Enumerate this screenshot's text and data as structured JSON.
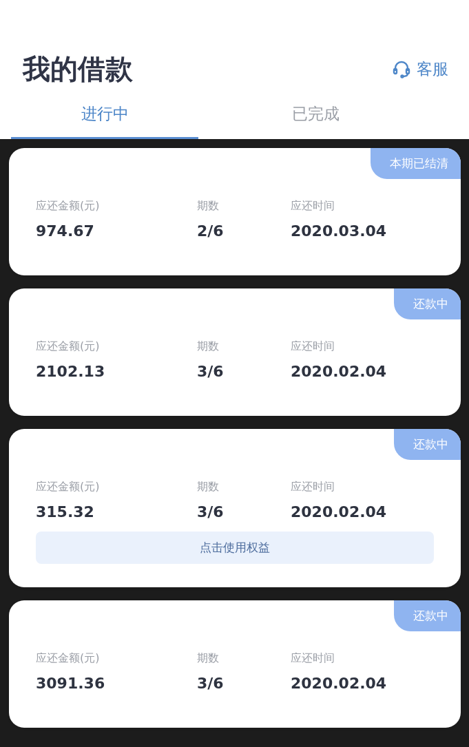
{
  "title": "我的借款",
  "service": {
    "label": "客服"
  },
  "tabs": [
    {
      "label": "进行中",
      "selected": true
    },
    {
      "label": "已完成",
      "selected": false
    }
  ],
  "loans": [
    {
      "status": "本期已结清",
      "amount_label": "应还金额(元)",
      "amount": "974.67",
      "period_label": "期数",
      "period": "2/6",
      "date_label": "应还时间",
      "date": "2020.03.04"
    },
    {
      "status": "还款中",
      "amount_label": "应还金额(元)",
      "amount": "2102.13",
      "period_label": "期数",
      "period": "3/6",
      "date_label": "应还时间",
      "date": "2020.02.04"
    },
    {
      "status": "还款中",
      "amount_label": "应还金额(元)",
      "amount": "315.32",
      "period_label": "期数",
      "period": "3/6",
      "date_label": "应还时间",
      "date": "2020.02.04",
      "action": "点击使用权益"
    },
    {
      "status": "还款中",
      "amount_label": "应还金额(元)",
      "amount": "3091.36",
      "period_label": "期数",
      "period": "3/6",
      "date_label": "应还时间",
      "date": "2020.02.04"
    }
  ]
}
